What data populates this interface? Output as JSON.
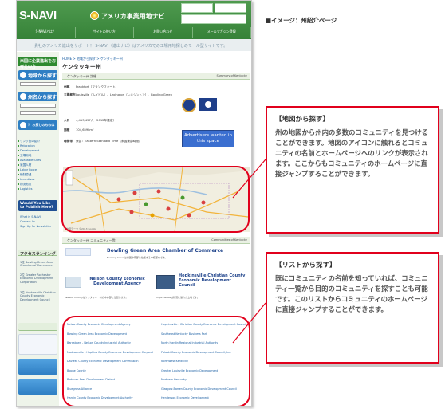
{
  "right_panel": {
    "title": "■イメージ：州紹介ページ",
    "callout_map": {
      "title": "【地図から探す】",
      "body": "州の地図から州内の多数のコミュニティを見つけることができます。地図のアイコンに触れるとコミュニティの名前とホームページへのリンクが表示されます。ここからもコミュニティのホームページに直接ジャンプすることができます。"
    },
    "callout_list": {
      "title": "【リストから探す】",
      "body": "既にコミュニティの名前を知っていれば、コミュニティ一覧から目的のコミュニティを探すことも可能です。このリストからコミュニティのホームページに直接ジャンプすることができます。"
    }
  },
  "site": {
    "logo": "S-NAVI",
    "name": "アメリカ事業用地ナビ",
    "tagline": "貴社のアメリカ進出をサポート！ S-NAVI（進出ナビ）はアメリカでの工場用地探しのモール型サイトです。"
  },
  "nav": [
    "S-NAVIとは？",
    "サイトの使い方",
    "お問い合わせ",
    "メールマガジン登録"
  ],
  "sidebar": {
    "head": "米国に企業進出をお考えの方",
    "buttons": [
      "地域から探す",
      "州名から探す"
    ],
    "search_label": "？ お探しのものは",
    "list": [
      "リンク集の紹介",
      "Relocation",
      "Development",
      "工場用地",
      "Available Sites",
      "米国人材",
      "Labor Force",
      "税制優遇",
      "Incentives",
      "物流拠点",
      "Logistics"
    ],
    "feature": "Would You Like to Publish Here?",
    "feature_links": [
      "What is S-NAVI",
      "Contact Us",
      "Sign Up for Newsletter"
    ],
    "ranking_head": "アクセスランキング",
    "ranking": [
      "1位 Bowling Green Area Chamber of Commerce",
      "2位 Greater Rochester Economic Development Corporation",
      "3位 Hopkinsville Christian County Economic Development Council"
    ]
  },
  "main": {
    "breadcrumb": "HOME > 地域から探す > ケンタッキー州",
    "title": "ケンタッキー州",
    "state_section": "ケンタッキー州 詳細",
    "state_section_right": "Summary of Kentucky",
    "info": [
      {
        "label": "州都",
        "value": "Frankfort（フランクフォート）"
      },
      {
        "label": "主要都市",
        "value": "Louisville（ルイビル）、Lexington（レキシントン）、Bowling Green"
      },
      {
        "label": "人口",
        "value": "4,413,457人（2012年推定）"
      },
      {
        "label": "面積",
        "value": "104,659km²"
      },
      {
        "label": "時間帯",
        "value": "東部：Eastern Standard Time（米国東部時間）"
      }
    ],
    "advert": "Advertisers wanted in this space",
    "map_footer": "地図データ ©2013 Google",
    "community_section": "ケンタッキー州 コミュニティ一覧",
    "community_section_right": "Communities of Kentucky",
    "featured": [
      {
        "name": "Bowling Green Area Chamber of Commerce",
        "desc": "Bowling Greenは米国中南部に位置する中核都市です。"
      },
      {
        "name": "Nelson County Economic Development Agency",
        "desc": "Nelson Countyはケンタッキー州の中心部に位置します。"
      },
      {
        "name": "Hopkinsville Christian County Economic Development Council",
        "desc": "Hopkinsvilleは物流に優れた立地です。"
      }
    ],
    "community_rows": [
      [
        "Nelson County Economic Development Agency",
        "Hopkinsville - Christian County Economic Development Council"
      ],
      [
        "Bowling Green Area Economic Development",
        "Southeast Kentucky Business Park"
      ],
      [
        "Bardstown - Nelson County Industrial Authority",
        "North Hardin Regional Industrial Authority"
      ],
      [
        "Madisonville - Hopkins County Economic Development Corporation",
        "Pulaski County Economic Development Council, Inc."
      ],
      [
        "Daviess County Economic Development Commission",
        "Northwest Kentucky"
      ],
      [
        "Boone County",
        "Greater Louisville Economic Development"
      ],
      [
        "Paducah Area Development District",
        "Northern Kentucky"
      ],
      [
        "Bluegrass Alliance",
        "Glasgow-Barren County Economic Development Council"
      ],
      [
        "Hardin County Economic Development Authority",
        "Henderson Economic Development"
      ]
    ]
  }
}
